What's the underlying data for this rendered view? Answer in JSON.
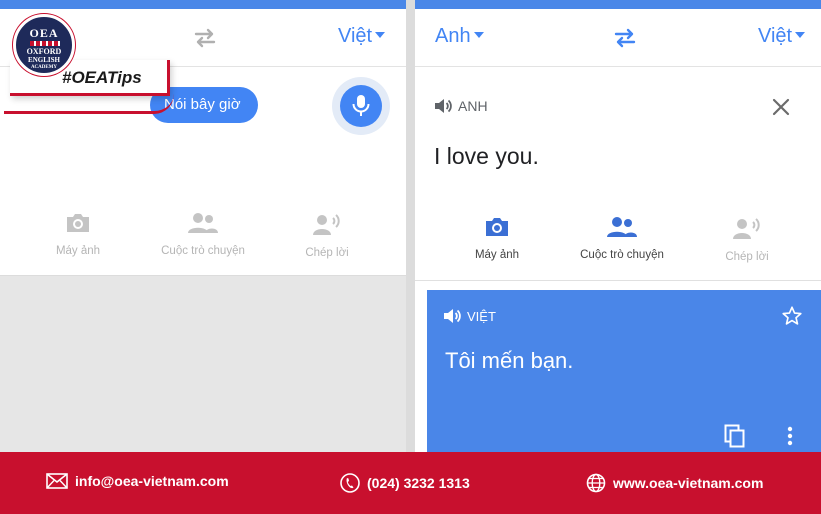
{
  "left_screen": {
    "target_language": "Việt",
    "speak_now_label": "Nói bây giờ",
    "tools": [
      {
        "label": "Máy ảnh",
        "icon": "camera-icon"
      },
      {
        "label": "Cuộc trò chuyện",
        "icon": "people-icon"
      },
      {
        "label": "Chép lời",
        "icon": "transcribe-icon"
      }
    ]
  },
  "right_screen": {
    "source_language": "Anh",
    "target_language": "Việt",
    "source_header": "ANH",
    "source_text": "I love you.",
    "tools": [
      {
        "label": "Máy ảnh",
        "icon": "camera-icon"
      },
      {
        "label": "Cuộc trò chuyện",
        "icon": "people-icon"
      },
      {
        "label": "Chép lời",
        "icon": "transcribe-icon"
      }
    ],
    "translation_header": "VIỆT",
    "translation_text": "Tôi mến bạn."
  },
  "badge": {
    "logo_oea": "OEA",
    "logo_lines": [
      "OXFORD",
      "ENGLISH",
      "ACADEMY"
    ],
    "hashtag": "#OEATips"
  },
  "footer": {
    "email": "info@oea-vietnam.com",
    "phone": "(024) 3232 1313",
    "website": "www.oea-vietnam.com"
  },
  "colors": {
    "accent_blue": "#4285f4",
    "card_blue": "#4a86e8",
    "brand_red": "#c8102e",
    "brand_navy": "#1e2a5a"
  }
}
